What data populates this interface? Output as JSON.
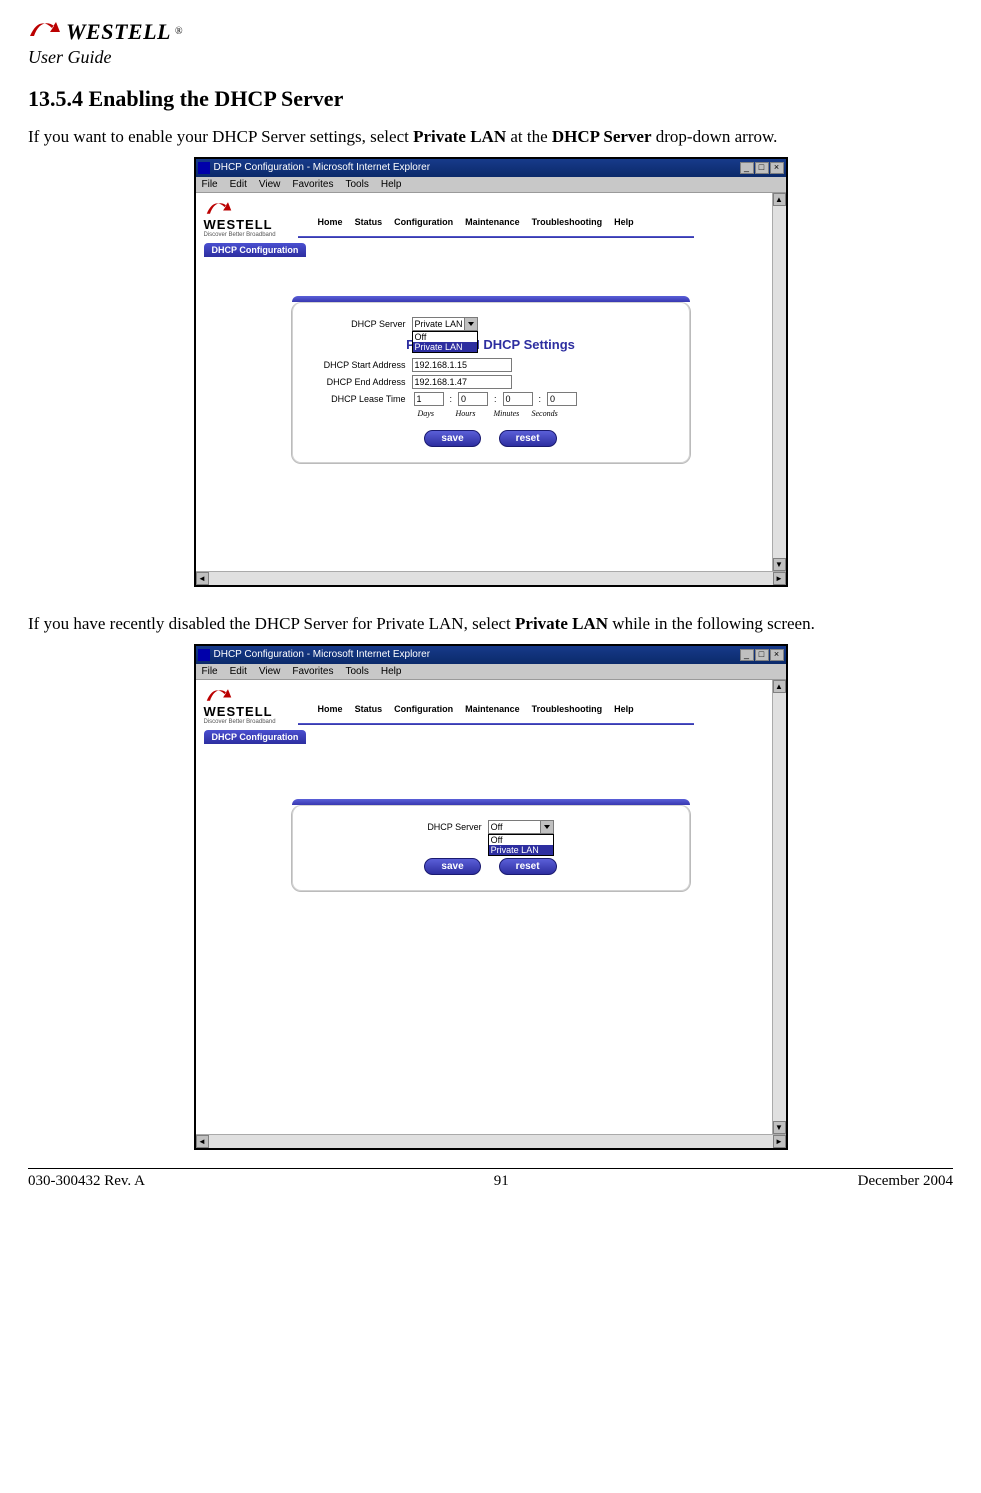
{
  "header": {
    "brand": "WESTELL",
    "guide_label": "User Guide"
  },
  "section": {
    "number": "13.5.4",
    "title": "Enabling the DHCP Server"
  },
  "paragraph1_pre": "If you want to enable your DHCP Server settings, select ",
  "paragraph1_bold1": "Private LAN",
  "paragraph1_mid": " at the ",
  "paragraph1_bold2": "DHCP Server",
  "paragraph1_post": " drop-down arrow.",
  "paragraph2_pre": "If you have recently disabled the DHCP Server for Private LAN, select ",
  "paragraph2_bold": "Private LAN",
  "paragraph2_post": " while in the following screen.",
  "ie": {
    "title": "DHCP Configuration - Microsoft Internet Explorer",
    "menu": {
      "file": "File",
      "edit": "Edit",
      "view": "View",
      "favorites": "Favorites",
      "tools": "Tools",
      "help": "Help"
    }
  },
  "brand_inline": {
    "name": "WESTELL",
    "tagline": "Discover Better Broadband"
  },
  "nav": {
    "items": [
      "Home",
      "Status",
      "Configuration",
      "Maintenance",
      "Troubleshooting",
      "Help"
    ],
    "tab": "DHCP Configuration"
  },
  "screenshot1": {
    "form": {
      "server_label": "DHCP Server",
      "server_value": "Private LAN",
      "dropdown_options": [
        "Off",
        "Private LAN"
      ],
      "dropdown_selected": "Private LAN",
      "settings_title": "Private LAN DHCP Settings",
      "start_label": "DHCP Start Address",
      "start_value": "192.168.1.15",
      "end_label": "DHCP End Address",
      "end_value": "192.168.1.47",
      "lease_label": "DHCP Lease Time",
      "lease": {
        "days": "1",
        "hours": "0",
        "minutes": "0",
        "seconds": "0"
      },
      "lease_units": {
        "days": "Days",
        "hours": "Hours",
        "minutes": "Minutes",
        "seconds": "Seconds"
      },
      "save": "save",
      "reset": "reset",
      "colon": ":"
    }
  },
  "screenshot2": {
    "form": {
      "server_label": "DHCP Server",
      "server_value": "Off",
      "dropdown_options": [
        "Off",
        "Private LAN"
      ],
      "dropdown_selected": "Private LAN",
      "save": "save",
      "reset": "reset"
    }
  },
  "footer": {
    "left": "030-300432 Rev. A",
    "center": "91",
    "right": "December 2004"
  }
}
